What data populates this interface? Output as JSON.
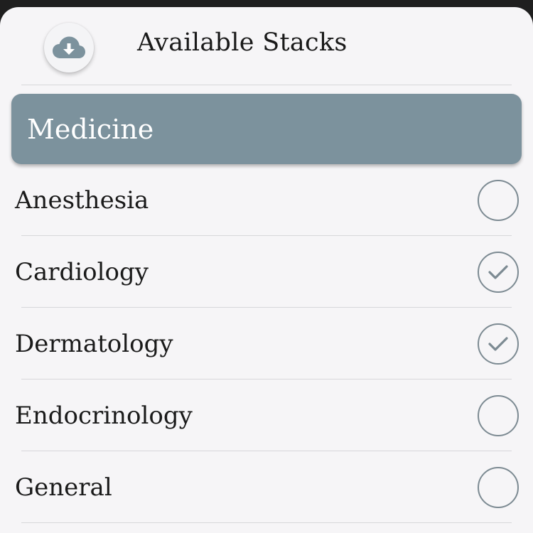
{
  "header": {
    "title": "Available Stacks",
    "download_icon": "cloud-download-icon"
  },
  "category": {
    "label": "Medicine",
    "color": "#7c929d"
  },
  "stacks": [
    {
      "label": "Anesthesia",
      "checked": false
    },
    {
      "label": "Cardiology",
      "checked": true
    },
    {
      "label": "Dermatology",
      "checked": true
    },
    {
      "label": "Endocrinology",
      "checked": false
    },
    {
      "label": "General",
      "checked": false
    }
  ],
  "icons": {
    "check": "checkmark-icon"
  }
}
